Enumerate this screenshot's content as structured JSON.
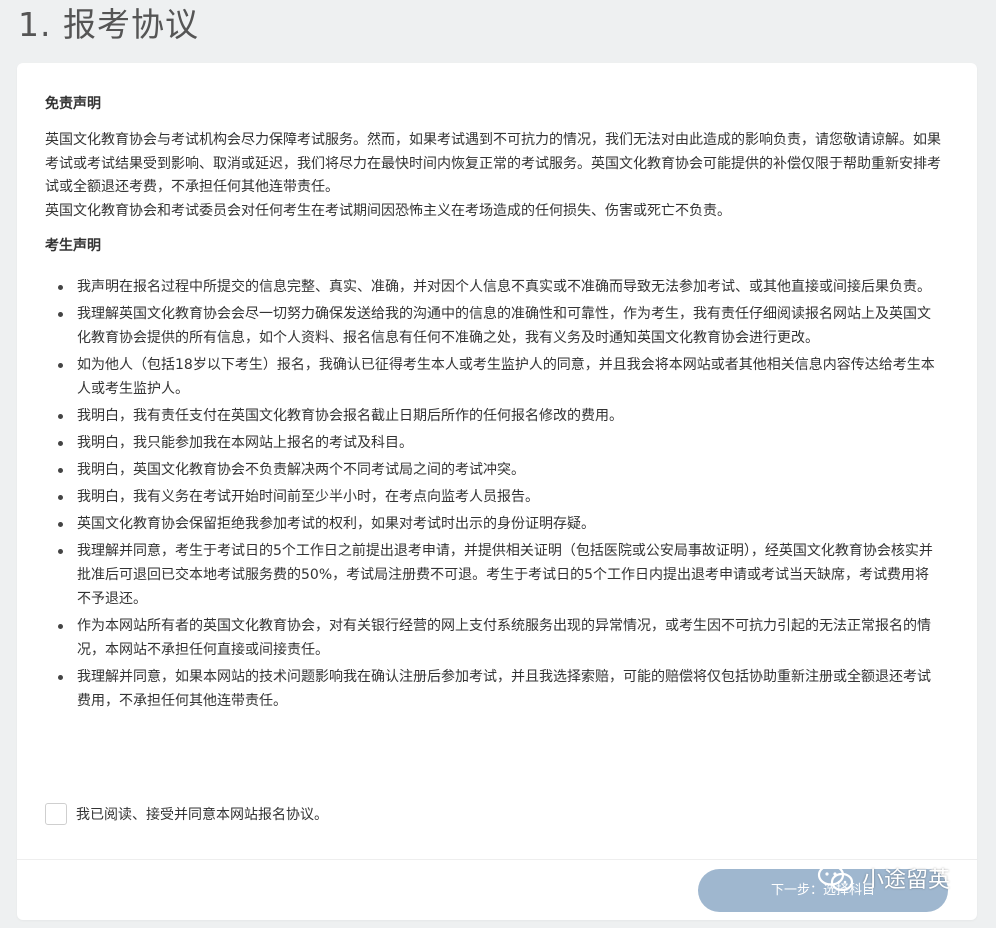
{
  "page": {
    "title": "1. 报考协议"
  },
  "disclaimer": {
    "heading": "免责声明",
    "paragraph_1": "英国文化教育协会与考试机构会尽力保障考试服务。然而，如果考试遇到不可抗力的情况，我们无法对由此造成的影响负责，请您敬请谅解。如果考试或考试结果受到影响、取消或延迟，我们将尽力在最快时间内恢复正常的考试服务。英国文化教育协会可能提供的补偿仅限于帮助重新安排考试或全额退还考费，不承担任何其他连带责任。",
    "paragraph_2": "英国文化教育协会和考试委员会对任何考生在考试期间因恐怖主义在考场造成的任何损失、伤害或死亡不负责。"
  },
  "declaration": {
    "heading": "考生声明",
    "items": [
      "我声明在报名过程中所提交的信息完整、真实、准确，并对因个人信息不真实或不准确而导致无法参加考试、或其他直接或间接后果负责。",
      "我理解英国文化教育协会会尽一切努力确保发送给我的沟通中的信息的准确性和可靠性，作为考生，我有责任仔细阅读报名网站上及英国文化教育协会提供的所有信息，如个人资料、报名信息有任何不准确之处，我有义务及时通知英国文化教育协会进行更改。",
      "如为他人（包括18岁以下考生）报名，我确认已征得考生本人或考生监护人的同意，并且我会将本网站或者其他相关信息内容传达给考生本人或考生监护人。",
      "我明白，我有责任支付在英国文化教育协会报名截止日期后所作的任何报名修改的费用。",
      "我明白，我只能参加我在本网站上报名的考试及科目。",
      "我明白，英国文化教育协会不负责解决两个不同考试局之间的考试冲突。",
      "我明白，我有义务在考试开始时间前至少半小时，在考点向监考人员报告。",
      "英国文化教育协会保留拒绝我参加考试的权利，如果对考试时出示的身份证明存疑。",
      "我理解并同意，考生于考试日的5个工作日之前提出退考申请，并提供相关证明（包括医院或公安局事故证明），经英国文化教育协会核实并批准后可退回已交本地考试服务费的50%，考试局注册费不可退。考生于考试日的5个工作日内提出退考申请或考试当天缺席，考试费用将不予退还。",
      "作为本网站所有者的英国文化教育协会，对有关银行经营的网上支付系统服务出现的异常情况，或考生因不可抗力引起的无法正常报名的情况，本网站不承担任何直接或间接责任。",
      "我理解并同意，如果本网站的技术问题影响我在确认注册后参加考试，并且我选择索赔，可能的赔偿将仅包括协助重新注册或全额退还考试费用，不承担任何其他连带责任。"
    ]
  },
  "agreement": {
    "checked": false,
    "label": "我已阅读、接受并同意本网站报名协议。"
  },
  "footer": {
    "next_button_label": "下一步：选择科目",
    "next_button_color": "#9fb7cf"
  },
  "watermark": {
    "icon": "wechat-icon",
    "text": "小途留英"
  }
}
